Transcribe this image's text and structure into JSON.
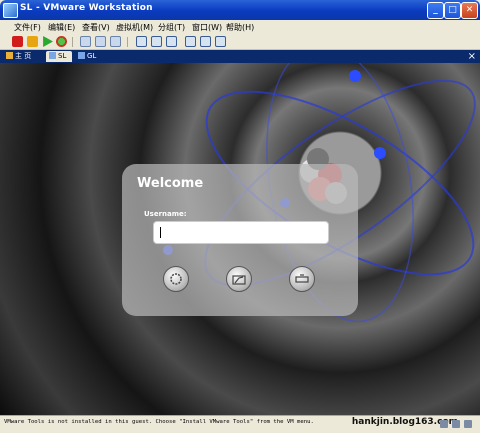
{
  "window": {
    "title": "SL - VMware Workstation",
    "minimize": "_",
    "maximize": "□",
    "close": "✕"
  },
  "menu": [
    {
      "label": "文件(F)"
    },
    {
      "label": "编辑(E)"
    },
    {
      "label": "查看(V)"
    },
    {
      "label": "虚拟机(M)"
    },
    {
      "label": "分组(T)"
    },
    {
      "label": "窗口(W)"
    },
    {
      "label": "帮助(H)"
    }
  ],
  "tabs": [
    {
      "label": "主 页"
    },
    {
      "label": "SL"
    },
    {
      "label": "GL"
    }
  ],
  "tab_close": "×",
  "login": {
    "title": "Welcome",
    "username_label": "Username:",
    "username_value": ""
  },
  "status": {
    "message": "VMware Tools is not installed in this guest. Choose \"Install VMware Tools\" from the VM menu.",
    "watermark": "hankjin.blog163.com"
  },
  "colors": {
    "titlebar": "#0a3bbf",
    "tabbar": "#0a2a6c",
    "orbit": "#2a3bd8"
  }
}
